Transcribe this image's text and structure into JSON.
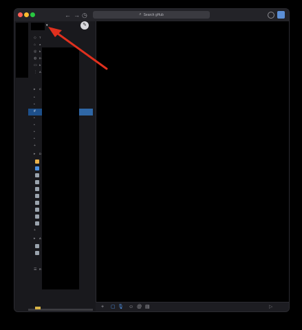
{
  "app": {
    "search_placeholder": "Search gHub"
  },
  "titlebar": {
    "back": "←",
    "forward": "→",
    "history": "◷",
    "help": "?",
    "search_glyph": "⌕"
  },
  "sidebar": {
    "caret": "▾",
    "compose_glyph": "✎",
    "nav_icons": [
      "◇",
      "⌂",
      "◎",
      "◍",
      "▭",
      "⋮"
    ],
    "nav_labels": [
      "T",
      "a",
      "b",
      "D",
      "b",
      "A"
    ],
    "channel_rows": [
      {
        "icon": "▸",
        "label": "C"
      },
      {
        "icon": "•",
        "label": "#"
      },
      {
        "icon": "•",
        "label": "#"
      },
      {
        "icon": "•",
        "label": "#"
      },
      {
        "icon": "#",
        "label": "#"
      },
      {
        "icon": "•",
        "label": "#"
      },
      {
        "icon": "•",
        "label": "#"
      },
      {
        "icon": "•",
        "label": "#"
      },
      {
        "icon": "•",
        "label": "#"
      },
      {
        "icon": "+",
        "label": ""
      }
    ],
    "dm_header": {
      "icon": "▸",
      "label": "D"
    },
    "dm_rows": [
      "",
      "",
      "",
      "",
      "",
      "",
      "",
      "",
      "",
      "",
      ""
    ],
    "apps_header": {
      "icon": "▸",
      "label": "A"
    },
    "apps_rows": [
      "",
      "",
      ""
    ],
    "footer_icon": "☰",
    "footer_label": "R"
  },
  "composer": {
    "plus": "+",
    "video": "▢",
    "mic": "🎙",
    "emoji": "☺",
    "mention": "@",
    "format": "▤",
    "send": "▷"
  },
  "colors": {
    "accent": "#2f67a6",
    "arrow": "#e0301e"
  }
}
